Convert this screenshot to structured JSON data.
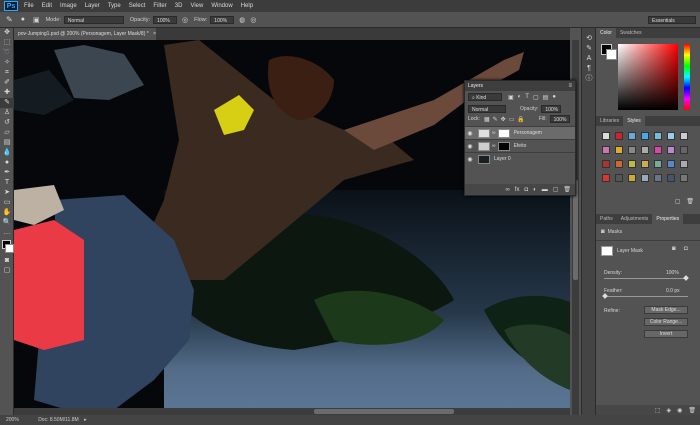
{
  "app": {
    "logo": "Ps"
  },
  "menu": [
    "File",
    "Edit",
    "Image",
    "Layer",
    "Type",
    "Select",
    "Filter",
    "3D",
    "View",
    "Window",
    "Help"
  ],
  "options": {
    "mode_label": "Mode:",
    "mode_value": "Normal",
    "opacity_label": "Opacity:",
    "opacity_value": "100%",
    "flow_label": "Flow:",
    "flow_value": "100%",
    "workspace": "Essentials"
  },
  "document": {
    "tab_title": "pov-Jumping1.psd @ 200% (Personagem, Layer Mask/8) *"
  },
  "status": {
    "zoom": "200%",
    "doc": "Doc: 8.50M/11.8M"
  },
  "color_panel": {
    "tabs": [
      "Color",
      "Swatches"
    ],
    "fg": "#000000",
    "bg": "#ffffff"
  },
  "libraries_panel": {
    "tabs": [
      "Libraries",
      "Styles"
    ]
  },
  "properties_panel": {
    "tabs": [
      "Paths",
      "Adjustments",
      "Properties"
    ],
    "section": "Masks",
    "mask_label": "Layer Mask",
    "density_label": "Density:",
    "density_value": "100%",
    "feather_label": "Feather:",
    "feather_value": "0.0 px",
    "refine_label": "Refine:",
    "mask_edge_btn": "Mask Edge...",
    "color_range_btn": "Color Range...",
    "invert_btn": "Invert"
  },
  "layers_panel": {
    "title": "Layers",
    "kind_label": "Kind",
    "blend_mode": "Normal",
    "opacity_label": "Opacity:",
    "opacity_value": "100%",
    "lock_label": "Lock:",
    "fill_label": "Fill:",
    "fill_value": "100%",
    "layers": [
      {
        "name": "Personagem"
      },
      {
        "name": "Efeito"
      },
      {
        "name": "Layer 0"
      }
    ]
  },
  "colors": {
    "accent": "#31a8ff",
    "ui_bg": "#535353",
    "menubar": "#3c3c3c"
  }
}
